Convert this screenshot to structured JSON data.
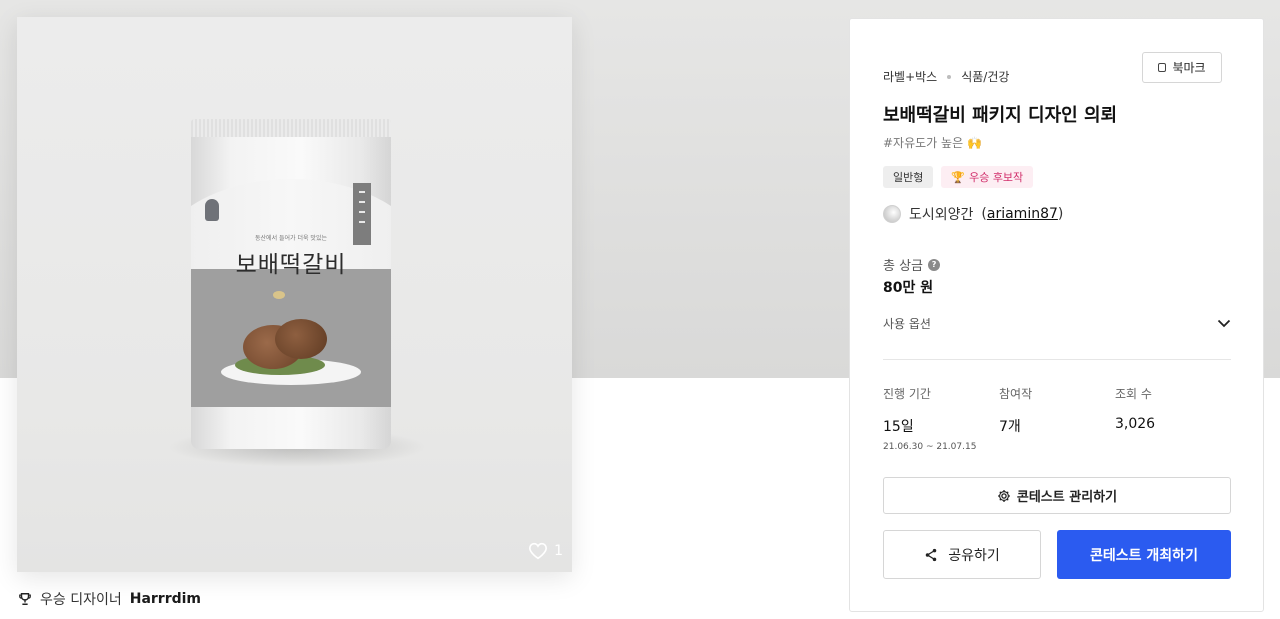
{
  "image_card": {
    "pouch": {
      "subtitle": "동산에서 들어가 더욱 맛있는",
      "title": "보배떡갈비",
      "side_label": "오아이감"
    },
    "like_count": "1"
  },
  "winner": {
    "label": "우승 디자이너",
    "name": "Harrrdim"
  },
  "panel": {
    "category_1": "라벨+박스",
    "category_2": "식품/건강",
    "bookmark_label": "북마크",
    "title": "보배떡갈비 패키지 디자인 의뢰",
    "hashtag": "#자유도가 높은",
    "badges": {
      "type": "일반형",
      "award": "우승 후보작"
    },
    "host": {
      "name": "도시외양간",
      "id": "ariamin87"
    },
    "prize_label": "총 상금",
    "prize_value": "80만 원",
    "usage_label": "사용 옵션",
    "stats": {
      "period_label": "진행 기간",
      "period_value": "15일",
      "period_range": "21.06.30 ~ 21.07.15",
      "entries_label": "참여작",
      "entries_value": "7개",
      "views_label": "조회 수",
      "views_value": "3,026"
    },
    "manage_label": "콘테스트 관리하기",
    "share_label": "공유하기",
    "host_contest_label": "콘테스트 개최하기"
  },
  "colors": {
    "primary": "#2b5bf0",
    "badge_pink_text": "#d12e6b",
    "badge_pink_bg": "#fdeef3"
  }
}
